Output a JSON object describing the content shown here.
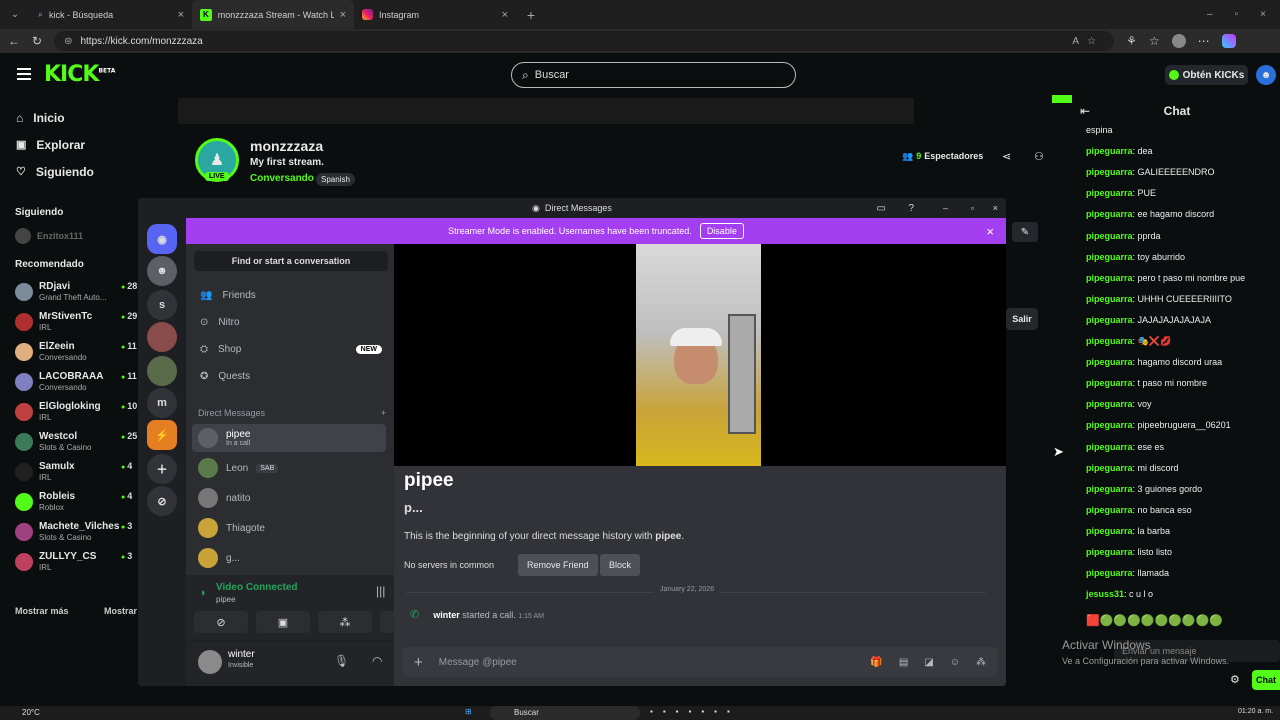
{
  "browser": {
    "tabs": [
      {
        "label": "kick - Búsqueda"
      },
      {
        "label": "monzzzaza Stream - Watch Live o"
      },
      {
        "label": "Instagram"
      }
    ],
    "url": "https://kick.com/monzzzaza"
  },
  "kick": {
    "search_placeholder": "Buscar",
    "kicks_button": "Obtén KICKs",
    "nav": [
      {
        "label": "Inicio"
      },
      {
        "label": "Explorar"
      },
      {
        "label": "Siguiendo"
      }
    ],
    "following_title": "Siguiendo",
    "following": [
      {
        "name": "Enzitox111"
      }
    ],
    "recommended_title": "Recomendado",
    "recommended": [
      {
        "name": "RDjavi",
        "sub": "Grand Theft Auto...",
        "count": "28",
        "color": "#7a8b99"
      },
      {
        "name": "MrStivenTc",
        "sub": "IRL",
        "count": "29",
        "color": "#b03030"
      },
      {
        "name": "ElZeein",
        "sub": "Conversando",
        "count": "11",
        "color": "#e0b080"
      },
      {
        "name": "LACOBRAAA",
        "sub": "Conversando",
        "count": "11",
        "color": "#8080c0"
      },
      {
        "name": "ElGlogloking",
        "sub": "IRL",
        "count": "10",
        "color": "#c04040"
      },
      {
        "name": "Westcol",
        "sub": "Slots & Casino",
        "count": "25",
        "color": "#3a7a5a"
      },
      {
        "name": "Samulx",
        "sub": "IRL",
        "count": "4",
        "color": "#202020"
      },
      {
        "name": "Robleis",
        "sub": "Roblox",
        "count": "4",
        "color": "#53fc18"
      },
      {
        "name": "Machete_Vilches",
        "sub": "Slots & Casino",
        "count": "3",
        "color": "#a04080"
      },
      {
        "name": "ZULLYY_CS",
        "sub": "IRL",
        "count": "3",
        "color": "#c04060"
      }
    ],
    "show_more": "Mostrar más",
    "show_less": "Mostrar",
    "streamer": {
      "name": "monzzzaza",
      "title": "My first stream.",
      "category": "Conversando",
      "tag": "Spanish",
      "live": "LIVE",
      "viewers": "9",
      "viewers_label": "Espectadores"
    },
    "salir": "Salir",
    "chat_title": "Chat",
    "chat_messages": [
      {
        "user": "",
        "text": "espina"
      },
      {
        "user": "pipeguarra",
        "text": "dea"
      },
      {
        "user": "pipeguarra",
        "text": "GALIEEEEENDRO"
      },
      {
        "user": "pipeguarra",
        "text": "PUE"
      },
      {
        "user": "pipeguarra",
        "text": "ee hagamo discord"
      },
      {
        "user": "pipeguarra",
        "text": "pprda"
      },
      {
        "user": "pipeguarra",
        "text": "toy aburrido"
      },
      {
        "user": "pipeguarra",
        "text": "pero t paso mi nombre pue"
      },
      {
        "user": "pipeguarra",
        "text": "UHHH CUEEEERIIIITO"
      },
      {
        "user": "pipeguarra",
        "text": "JAJAJAJAJAJAJA"
      },
      {
        "user": "pipeguarra",
        "text": "🎭❌💋"
      },
      {
        "user": "pipeguarra",
        "text": "hagamo discord uraa"
      },
      {
        "user": "pipeguarra",
        "text": "t paso mi nombre"
      },
      {
        "user": "pipeguarra",
        "text": "voy"
      },
      {
        "user": "pipeguarra",
        "text": "pipeebruguera__06201"
      },
      {
        "user": "pipeguarra",
        "text": "ese es"
      },
      {
        "user": "pipeguarra",
        "text": "mi discord"
      },
      {
        "user": "pipeguarra",
        "text": "3 guiones gordo"
      },
      {
        "user": "pipeguarra",
        "text": "no banca eso"
      },
      {
        "user": "pipeguarra",
        "text": "la barba"
      },
      {
        "user": "pipeguarra",
        "text": "listo listo"
      },
      {
        "user": "pipeguarra",
        "text": "llamada"
      },
      {
        "user": "jesuss31",
        "text": "c u l o"
      }
    ],
    "chat_input_placeholder": "Enviar un mensaje",
    "chat_button": "Chat",
    "activate_windows": "Activar Windows",
    "activate_windows_sub": "Ve a Configuración para activar Windows."
  },
  "discord": {
    "window_title": "Direct Messages",
    "banner_text": "Streamer Mode is enabled. Usernames have been truncated.",
    "banner_button": "Disable",
    "find_conversation": "Find or start a conversation",
    "nav": [
      {
        "label": "Friends"
      },
      {
        "label": "Nitro"
      },
      {
        "label": "Shop",
        "badge": "NEW"
      },
      {
        "label": "Quests"
      }
    ],
    "dm_title": "Direct Messages",
    "dms": [
      {
        "name": "pipee",
        "status": "In a call"
      },
      {
        "name": "Leon",
        "tag": "SAB"
      },
      {
        "name": "natito"
      },
      {
        "name": "Thiagote"
      },
      {
        "name": "g..."
      }
    ],
    "voice_status": "Video Connected",
    "voice_channel": "pipee",
    "user": {
      "name": "winter",
      "status": "Invisible"
    },
    "servers": [
      "s",
      "m"
    ],
    "profile": {
      "name": "pipee",
      "handle": "p...",
      "intro_prefix": "This is the beginning of your direct message history with ",
      "intro_name": "pipee",
      "no_servers": "No servers in common",
      "remove_friend": "Remove Friend",
      "block": "Block"
    },
    "date_divider": "January 22, 2026",
    "call_log": {
      "user": "winter",
      "text": "started a call.",
      "time": "1:15 AM"
    },
    "message_placeholder": "Message @pipee"
  },
  "taskbar": {
    "weather": "20°C",
    "search": "Buscar",
    "time": "01:20 a. m."
  },
  "colors": {
    "kick_green": "#53fc18",
    "discord_blurple": "#5865f2",
    "streamer_banner": "#a33ef1"
  }
}
